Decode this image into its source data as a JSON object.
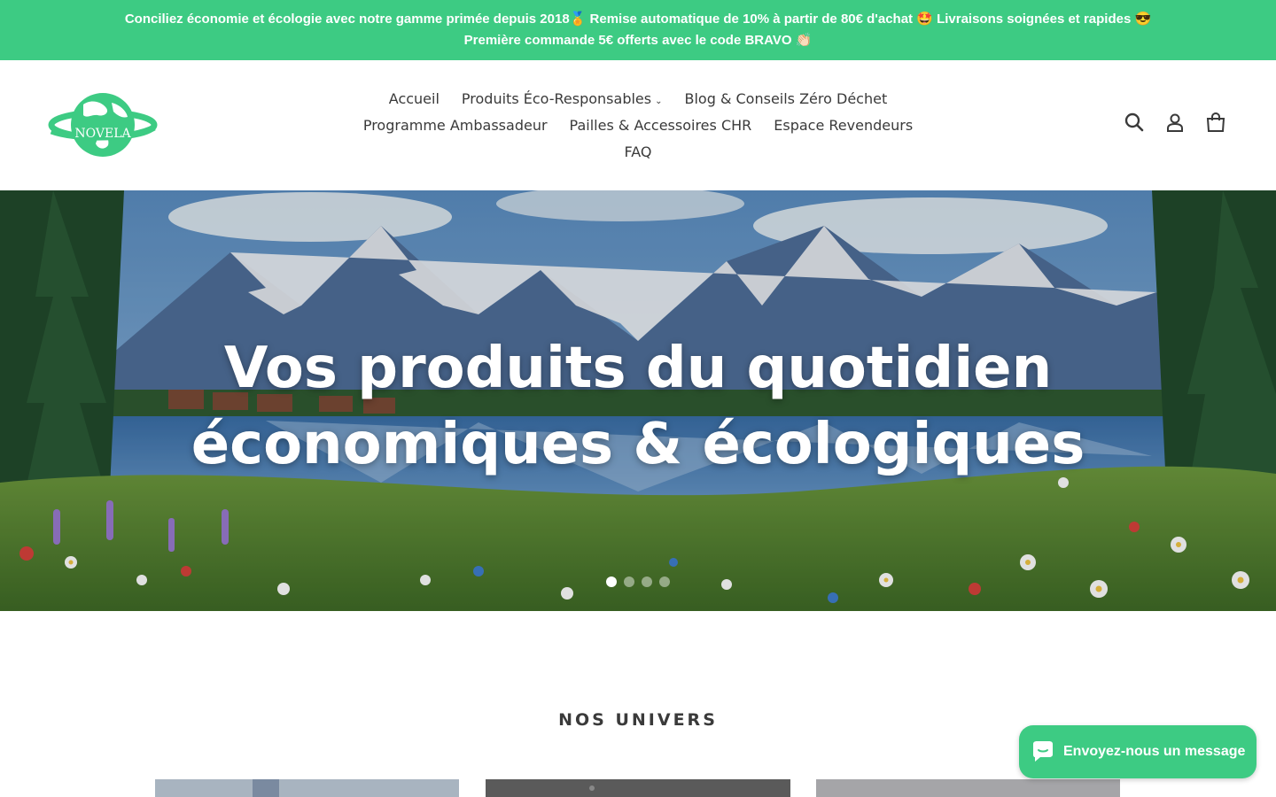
{
  "announcement": {
    "line1": "Conciliez économie et écologie avec notre gamme primée depuis 2018🏅 Remise automatique de 10% à partir de 80€ d'achat 🤩 Livraisons soignées et rapides 😎",
    "line2": "Première commande 5€ offerts avec le code BRAVO 👏🏻"
  },
  "brand": {
    "name": "NOVELA",
    "color": "#3dcb83"
  },
  "nav": {
    "row1": [
      {
        "label": "Accueil"
      },
      {
        "label": "Produits Éco-Responsables",
        "dropdown": true
      },
      {
        "label": "Blog & Conseils Zéro Déchet"
      }
    ],
    "row2": [
      {
        "label": "Programme Ambassadeur"
      },
      {
        "label": "Pailles & Accessoires CHR"
      },
      {
        "label": "Espace Revendeurs"
      }
    ],
    "row3": [
      {
        "label": "FAQ"
      }
    ]
  },
  "header_icons": [
    "search-icon",
    "account-icon",
    "cart-icon"
  ],
  "hero": {
    "title_line1": "Vos produits du quotidien",
    "title_line2": "économiques & écologiques",
    "slides": 4,
    "active_slide": 1
  },
  "section": {
    "title": "NOS UNIVERS"
  },
  "chat": {
    "label": "Envoyez-nous un message"
  }
}
